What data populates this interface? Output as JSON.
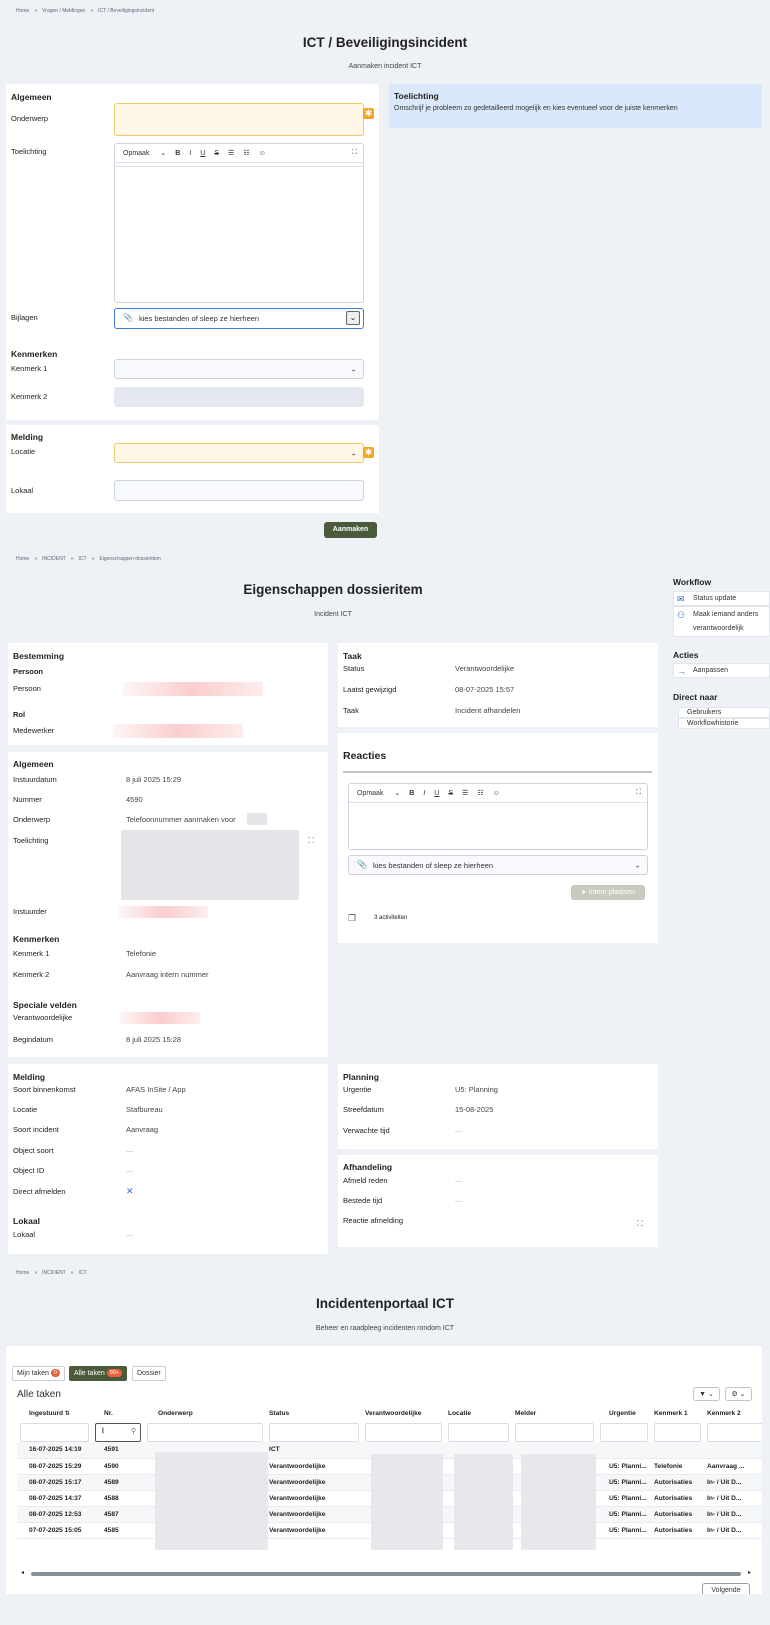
{
  "s1": {
    "breadcrumb": [
      "Home",
      "»",
      "Vragen / Meldingen",
      "»",
      "ICT / Beveiligingsincident"
    ],
    "title": "ICT / Beveiligingsincident",
    "subtitle": "Aanmaken incident ICT",
    "algemeen": "Algemeen",
    "onderwerp": "Onderwerp",
    "toelichting": "Toelichting",
    "opmaak": "Opmaak",
    "bijlagen": "Bijlagen",
    "bijlagen_placeholder": "kies bestanden of sleep ze hierheen",
    "kenmerken": "Kenmerken",
    "kenmerk1": "Kenmerk 1",
    "kenmerk2": "Kenmerk 2",
    "melding": "Melding",
    "locatie": "Locatie",
    "lokaal": "Lokaal",
    "help_title": "Toelichting",
    "help_text": "Omschrijf je probleem zo gedetailleerd mogelijk en kies eventueel voor de juiste kenmerken",
    "aanmaken": "Aanmaken"
  },
  "s2": {
    "breadcrumb": [
      "Home",
      "»",
      "INCIDENT",
      "»",
      "ICT",
      "»",
      "Eigenschappen dossieritem"
    ],
    "title": "Eigenschappen dossieritem",
    "subtitle": "Incident ICT",
    "bestemming": "Bestemming",
    "persoon_h": "Persoon",
    "persoon": "Persoon",
    "rol": "Rol",
    "medewerker": "Medewerker",
    "algemeen": "Algemeen",
    "instuurdatum_l": "Instuurdatum",
    "instuurdatum_v": "8 juli 2025 15:29",
    "nummer_l": "Nummer",
    "nummer_v": "4590",
    "onderwerp_l": "Onderwerp",
    "onderwerp_v": "Telefoonnummer aanmaken voor",
    "toelichting_l": "Toelichting",
    "instuurder_l": "Instuurder",
    "kenmerken": "Kenmerken",
    "kenmerk1_l": "Kenmerk 1",
    "kenmerk1_v": "Telefonie",
    "kenmerk2_l": "Kenmerk 2",
    "kenmerk2_v": "Aanvraag intern nummer",
    "speciale": "Speciale velden",
    "verantw_l": "Verantwoordelijke",
    "begindatum_l": "Begindatum",
    "begindatum_v": "8 juli 2025 15:28",
    "taak_h": "Taak",
    "status_l": "Status",
    "status_v": "Verantwoordelijke",
    "laatst_l": "Laatst gewijzigd",
    "laatst_v": "08-07-2025 15:57",
    "taak_l": "Taak",
    "taak_v": "Incident afhandelen",
    "reacties": "Reacties",
    "opmaak": "Opmaak",
    "bijlagen_placeholder": "kies bestanden of sleep ze hierheen",
    "intern_plaatsen": "Intern plaatsen",
    "activiteiten": "3 activiteiten",
    "melding": "Melding",
    "soort_l": "Soort binnenkomst",
    "soort_v": "AFAS InSite / App",
    "locatie_l": "Locatie",
    "locatie_v": "Stafbureau",
    "soortinc_l": "Soort incident",
    "soortinc_v": "Aanvraag",
    "objsoort_l": "Object soort",
    "objsoort_v": "—",
    "objid_l": "Object ID",
    "objid_v": "—",
    "direct_l": "Direct afmelden",
    "direct_v": "✕",
    "lokaal_h": "Lokaal",
    "lokaal_l": "Lokaal",
    "lokaal_v": "—",
    "planning": "Planning",
    "urgentie_l": "Urgentie",
    "urgentie_v": "U5: Planning",
    "streef_l": "Streefdatum",
    "streef_v": "15-08-2025",
    "verw_l": "Verwachte tijd",
    "verw_v": "—",
    "afhandeling": "Afhandeling",
    "afmeld_l": "Afmeld reden",
    "afmeld_v": "—",
    "bestede_l": "Bestede tijd",
    "bestede_v": "—",
    "reactie_l": "Reactie afmelding",
    "workflow": "Workflow",
    "status_update": "Status update",
    "maak_1": "Maak iemand anders",
    "maak_2": "verantwoordelijk",
    "acties": "Acties",
    "aanpassen": "Aanpassen",
    "direct_naar": "Direct naar",
    "gebruikers": "Gebruikers",
    "workflowhistorie": "Workflowhistorie"
  },
  "s3": {
    "breadcrumb": [
      "Home",
      "»",
      "INCIDENT",
      "»",
      "ICT"
    ],
    "title": "Incidentenportaal ICT",
    "subtitle": "Beheer en raadpleeg incidenten rondom ICT",
    "tab_mijn": "Mijn taken",
    "tab_mijn_count": "0",
    "tab_alle": "Alle taken",
    "tab_alle_count": "99+",
    "tab_dossier": "Dossier",
    "list_title": "Alle taken",
    "filter_icon": "▼ ⌄",
    "settings_icon": "⚙ ⌄",
    "columns": [
      "Ingestuurd",
      "Nr.",
      "Onderwerp",
      "Status",
      "Verantwoordelijke",
      "Locatie",
      "Melder",
      "Urgentie",
      "Kenmerk 1",
      "Kenmerk 2"
    ],
    "rows": [
      [
        "16-07-2025 14:19",
        "4591",
        "",
        "ICT",
        "",
        "",
        "",
        "",
        "",
        ""
      ],
      [
        "08-07-2025 15:29",
        "4590",
        "",
        "Verantwoordelijke",
        "",
        "",
        "",
        "U5: Planni...",
        "Telefonie",
        "Aanvraag ..."
      ],
      [
        "08-07-2025 15:17",
        "4589",
        "",
        "Verantwoordelijke",
        "",
        "",
        "",
        "U5: Planni...",
        "Autorisaties",
        "In- / Uit D..."
      ],
      [
        "08-07-2025 14:37",
        "4588",
        "",
        "Verantwoordelijke",
        "",
        "",
        "",
        "U5: Planni...",
        "Autorisaties",
        "In- / Uit D..."
      ],
      [
        "08-07-2025 12:53",
        "4587",
        "",
        "Verantwoordelijke",
        "",
        "",
        "",
        "U5: Planni...",
        "Autorisaties",
        "In- / Uit D..."
      ],
      [
        "07-07-2025 15:05",
        "4585",
        "",
        "Verantwoordelijke",
        "",
        "",
        "",
        "U5: Planni...",
        "Autorisaties",
        "In- / Uit D..."
      ]
    ],
    "volgende": "Volgende"
  }
}
